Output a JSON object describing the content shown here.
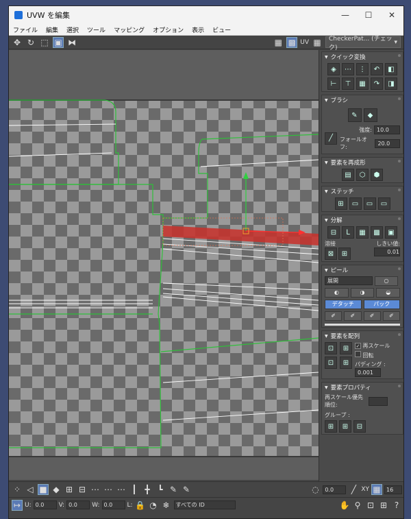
{
  "window": {
    "title": "UVW を編集",
    "controls": {
      "minimize": "—",
      "maximize": "☐",
      "close": "✕"
    }
  },
  "menu": [
    "ファイル",
    "編集",
    "選択",
    "ツール",
    "マッピング",
    "オプション",
    "表示",
    "ビュー"
  ],
  "toolbar": {
    "uv_label": "UV",
    "texture_combo": "CheckerPat... (チェック)",
    "uv_combo_arrow": "▾"
  },
  "panel": {
    "quick_transform": {
      "title": "クイック変換"
    },
    "brush": {
      "title": "ブラシ",
      "strength_label": "強度:",
      "strength_value": "10.0",
      "falloff_label": "フォールオフ:",
      "falloff_value": "20.0"
    },
    "reshape": {
      "title": "要素を再成形"
    },
    "stitch": {
      "title": "ステッチ"
    },
    "explode": {
      "title": "分解",
      "weld_label": "溶接",
      "threshold_label": "しきい値:",
      "threshold_value": "0.01"
    },
    "peel": {
      "title": "ピール",
      "mode_value": "展開",
      "detach_label": "デタッチ",
      "pack_label": "パック"
    },
    "arrange": {
      "title": "要素を配列",
      "rescale_label": "再スケール",
      "rotate_label": "回転",
      "padding_label": "パディング :",
      "padding_value": "0.001"
    },
    "element_props": {
      "title": "要素プロパティ",
      "rescale_priority_label": "再スケール優先順位:",
      "group_label": "グループ :"
    }
  },
  "status": {
    "angle_value": "0.0",
    "xy_label": "XY",
    "grid_value": "16",
    "u_label": "U:",
    "u_value": "0.0",
    "v_label": "V:",
    "v_value": "0.0",
    "w_label": "W:",
    "w_value": "0.0",
    "l_label": "L:",
    "id_filter": "すべての ID"
  },
  "colors": {
    "accent": "#5b8ad6",
    "seam": "#2fbf3a",
    "selection": "#d8382f"
  }
}
